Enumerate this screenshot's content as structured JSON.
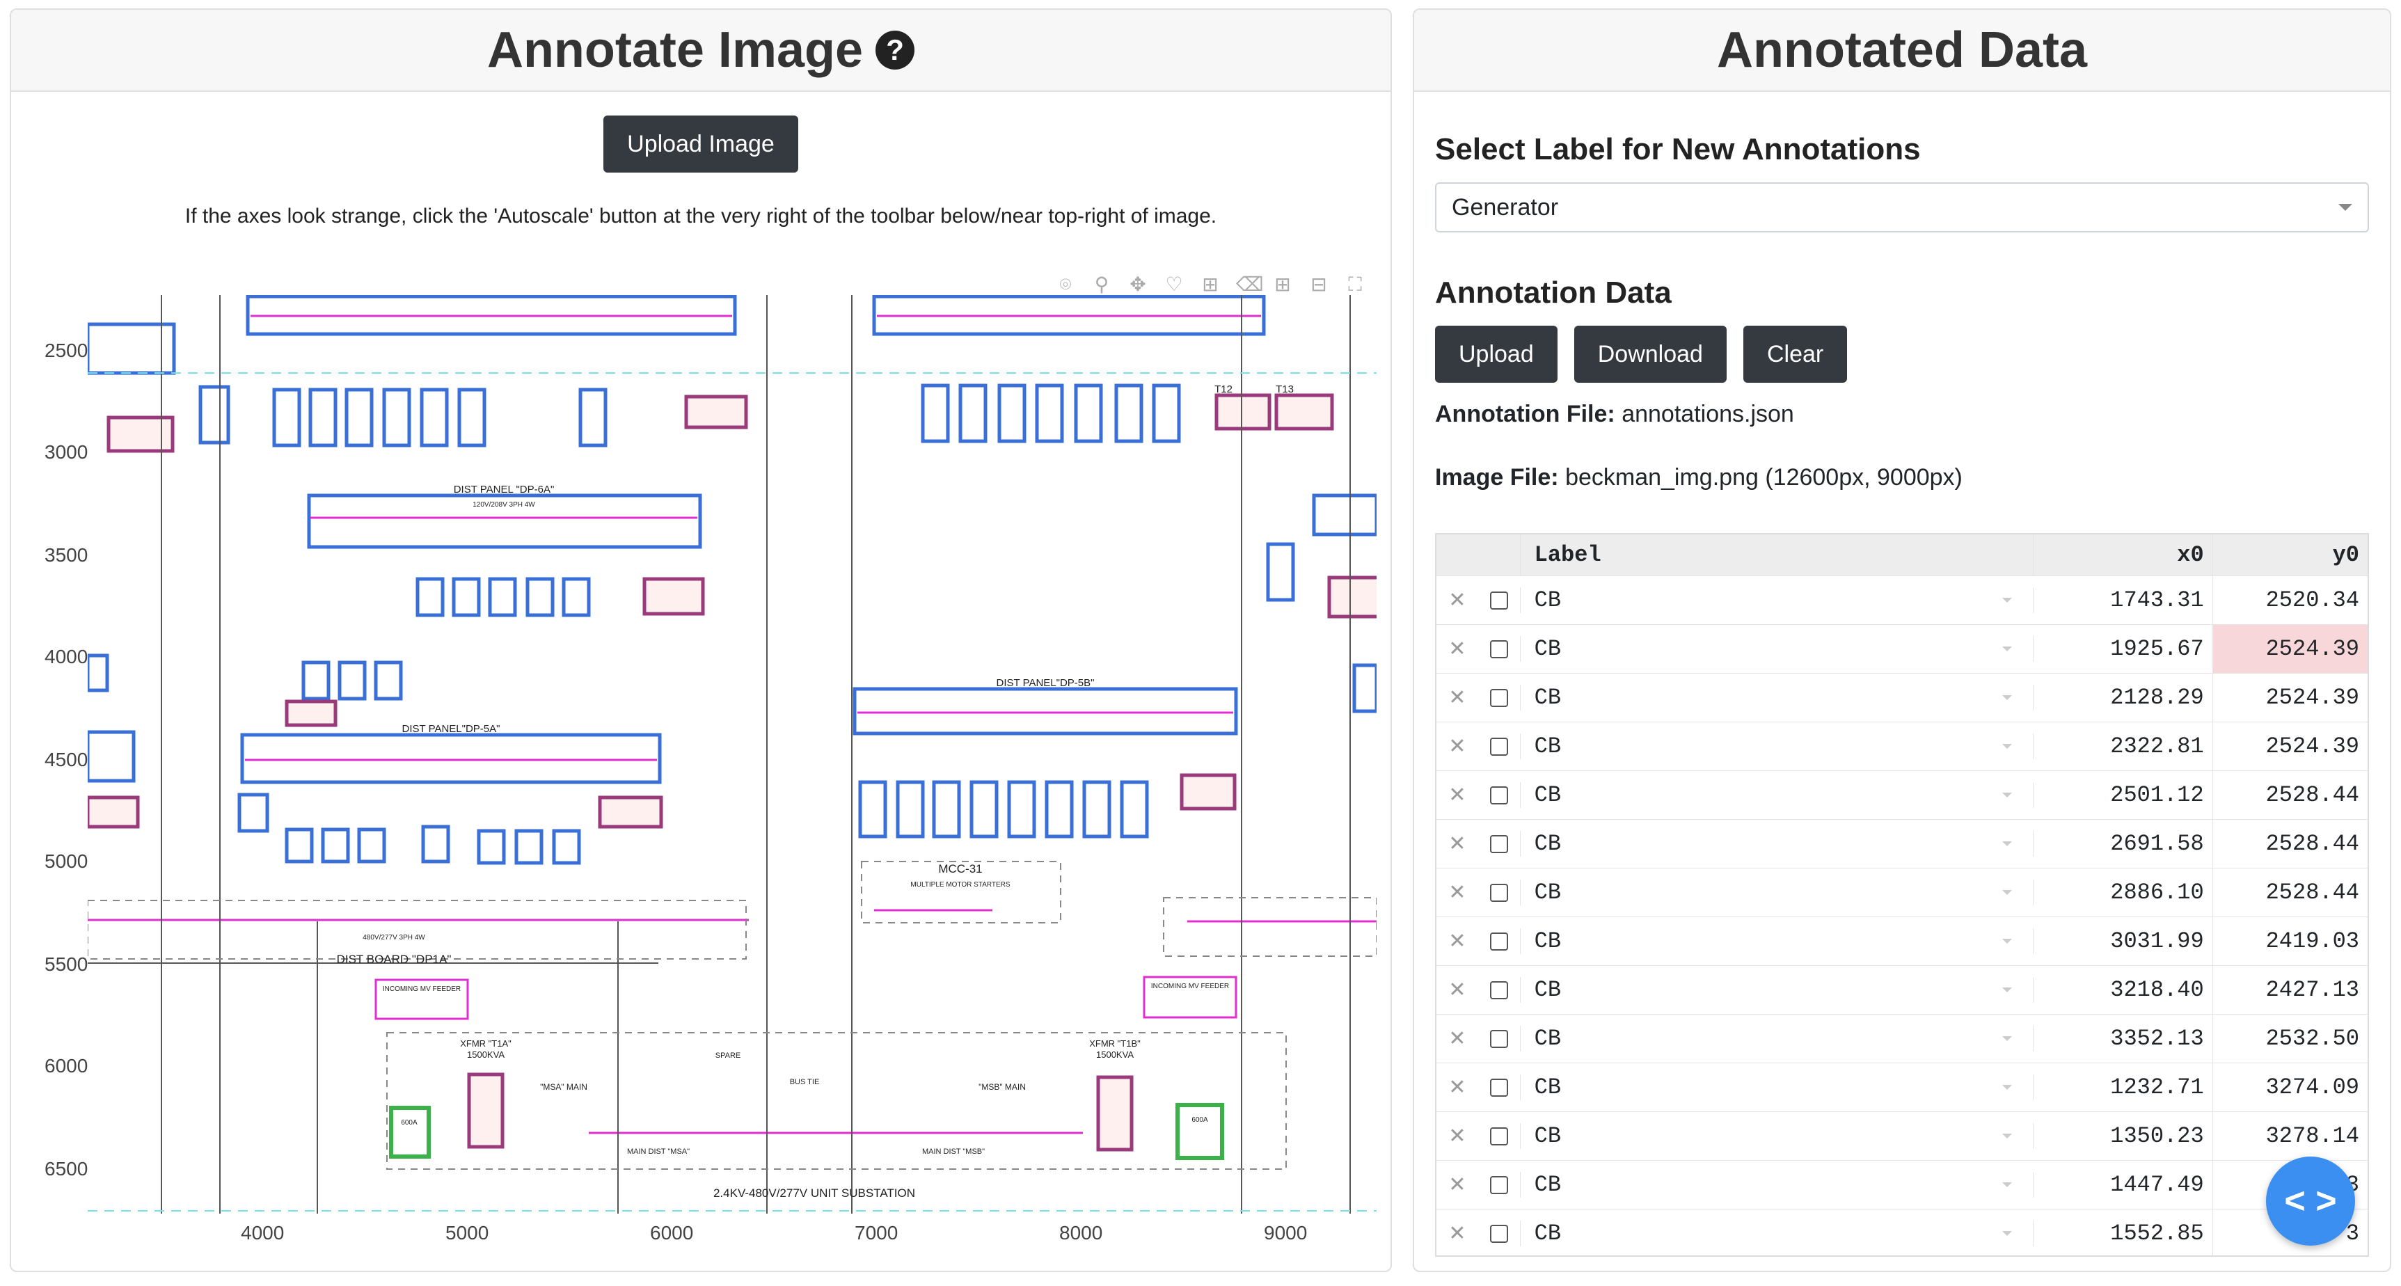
{
  "left": {
    "title": "Annotate Image",
    "help_glyph": "?",
    "upload_label": "Upload Image",
    "hint": "If the axes look strange, click the 'Autoscale' button at the very right of the toolbar below/near top-right of image.",
    "y_ticks": [
      "2500",
      "3000",
      "3500",
      "4000",
      "4500",
      "5000",
      "5500",
      "6000",
      "6500"
    ],
    "x_ticks": [
      "4000",
      "5000",
      "6000",
      "7000",
      "8000",
      "9000"
    ],
    "toolbar_icons": [
      "camera-icon",
      "zoom-icon",
      "pan-icon",
      "lasso-icon",
      "draw-rect-icon",
      "erase-icon",
      "zoom-in-icon",
      "zoom-out-icon",
      "autoscale-icon"
    ],
    "diagram": {
      "labels": {
        "dp6a": "DIST PANEL \"DP-6A\"",
        "dp6a_sub": "120V/208V 3PH 4W",
        "dp5a": "DIST PANEL\"DP-5A\"",
        "dp5b": "DIST PANEL\"DP-5B\"",
        "mcc": "MCC-31",
        "mcc_sub": "MULTIPLE MOTOR STARTERS",
        "dp1a": "DIST BOARD \"DP1A\"",
        "dp1a_sub": "480V/277V 3PH 4W",
        "feeder_left": "INCOMING MV FEEDER",
        "feeder_right": "INCOMING MV FEEDER",
        "xfmr_left": "XFMR \"T1A\"",
        "xfmr_right": "XFMR \"T1B\"",
        "xfmr_rating": "1500KVA",
        "msa": "\"MSA\" MAIN",
        "msb": "\"MSB\" MAIN",
        "main_a": "MAIN DIST \"MSA\"",
        "main_b": "MAIN DIST \"MSB\"",
        "substation": "2.4KV-480V/277V UNIT SUBSTATION",
        "spare": "SPARE",
        "bus_tie": "BUS TIE",
        "t12": "T12",
        "t13": "T13",
        "gen_left": "600A",
        "gen_right": "600A"
      }
    }
  },
  "right": {
    "title": "Annotated Data",
    "select_heading": "Select Label for New Annotations",
    "selected_label": "Generator",
    "data_heading": "Annotation Data",
    "buttons": {
      "upload": "Upload",
      "download": "Download",
      "clear": "Clear"
    },
    "annotation_file_label": "Annotation File:",
    "annotation_file": "annotations.json",
    "image_file_label": "Image File:",
    "image_file": "beckman_img.png (12600px, 9000px)",
    "table": {
      "headers": {
        "label": "Label",
        "x0": "x0",
        "y0": "y0"
      },
      "rows": [
        {
          "label": "CB",
          "x0": "1743.31",
          "y0": "2520.34"
        },
        {
          "label": "CB",
          "x0": "1925.67",
          "y0": "2524.39"
        },
        {
          "label": "CB",
          "x0": "2128.29",
          "y0": "2524.39"
        },
        {
          "label": "CB",
          "x0": "2322.81",
          "y0": "2524.39"
        },
        {
          "label": "CB",
          "x0": "2501.12",
          "y0": "2528.44"
        },
        {
          "label": "CB",
          "x0": "2691.58",
          "y0": "2528.44"
        },
        {
          "label": "CB",
          "x0": "2886.10",
          "y0": "2528.44"
        },
        {
          "label": "CB",
          "x0": "3031.99",
          "y0": "2419.03"
        },
        {
          "label": "CB",
          "x0": "3218.40",
          "y0": "2427.13"
        },
        {
          "label": "CB",
          "x0": "3352.13",
          "y0": "2532.50"
        },
        {
          "label": "CB",
          "x0": "1232.71",
          "y0": "3274.09"
        },
        {
          "label": "CB",
          "x0": "1350.23",
          "y0": "3278.14"
        },
        {
          "label": "CB",
          "x0": "1447.49",
          "y0": "3"
        },
        {
          "label": "CB",
          "x0": "1552.85",
          "y0": "3"
        }
      ]
    }
  },
  "fab_glyph": "< >"
}
